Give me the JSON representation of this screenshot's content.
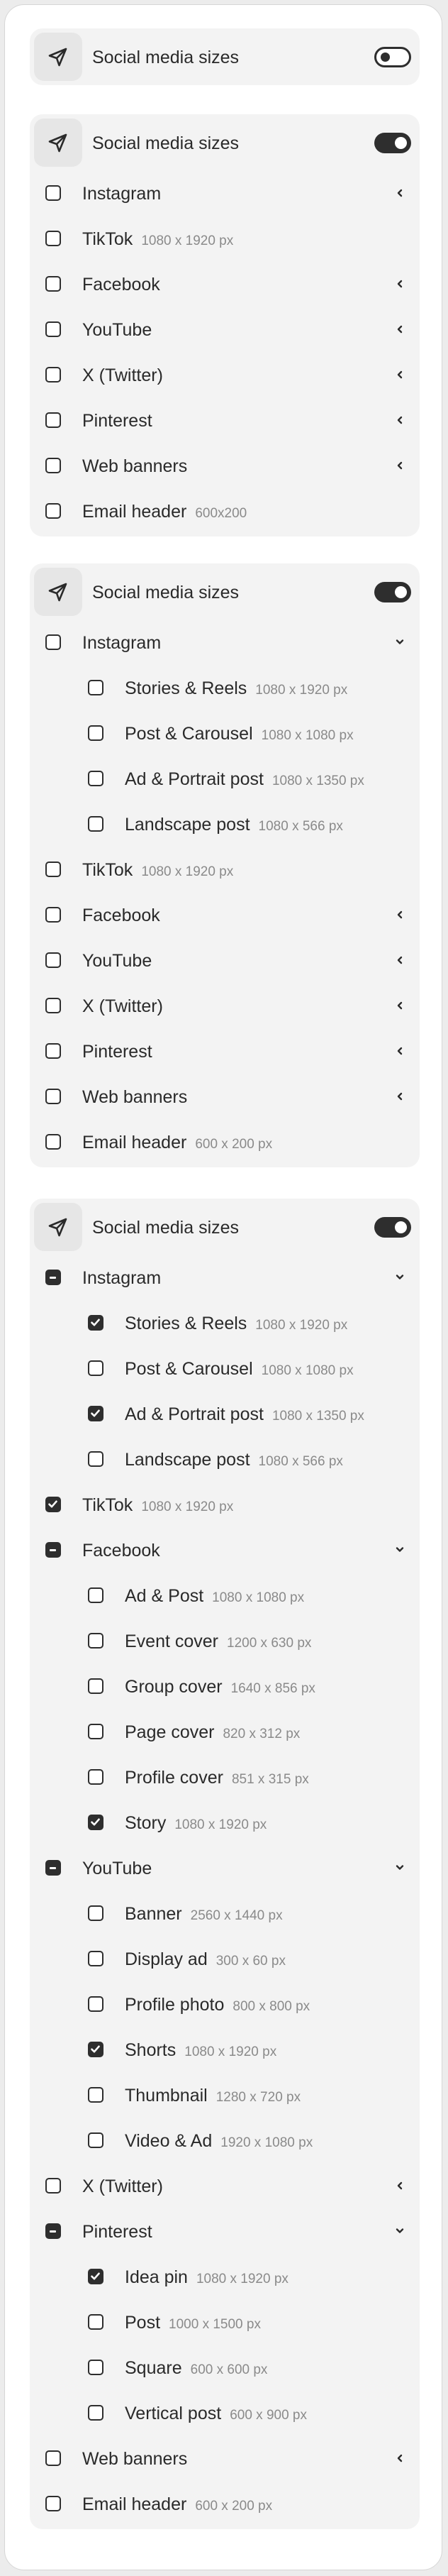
{
  "title": "Social media sizes",
  "cards": [
    {
      "toggle": "off",
      "items": []
    },
    {
      "toggle": "on",
      "items": [
        {
          "label": "Instagram",
          "state": "unchecked",
          "chevron": "left"
        },
        {
          "label": "TikTok",
          "size": "1080 x 1920 px",
          "state": "unchecked"
        },
        {
          "label": "Facebook",
          "state": "unchecked",
          "chevron": "left"
        },
        {
          "label": "YouTube",
          "state": "unchecked",
          "chevron": "left"
        },
        {
          "label": "X (Twitter)",
          "state": "unchecked",
          "chevron": "left"
        },
        {
          "label": "Pinterest",
          "state": "unchecked",
          "chevron": "left"
        },
        {
          "label": "Web banners",
          "state": "unchecked",
          "chevron": "left"
        },
        {
          "label": "Email header",
          "size": "600x200",
          "state": "unchecked"
        }
      ]
    },
    {
      "toggle": "on",
      "items": [
        {
          "label": "Instagram",
          "state": "unchecked",
          "chevron": "down"
        },
        {
          "label": "Stories & Reels",
          "size": "1080 x 1920 px",
          "state": "unchecked",
          "sub": true
        },
        {
          "label": "Post & Carousel",
          "size": "1080 x 1080 px",
          "state": "unchecked",
          "sub": true
        },
        {
          "label": "Ad & Portrait post",
          "size": "1080 x 1350 px",
          "state": "unchecked",
          "sub": true
        },
        {
          "label": "Landscape post",
          "size": "1080 x 566 px",
          "state": "unchecked",
          "sub": true
        },
        {
          "label": "TikTok",
          "size": "1080 x 1920 px",
          "state": "unchecked"
        },
        {
          "label": "Facebook",
          "state": "unchecked",
          "chevron": "left"
        },
        {
          "label": "YouTube",
          "state": "unchecked",
          "chevron": "left"
        },
        {
          "label": "X (Twitter)",
          "state": "unchecked",
          "chevron": "left"
        },
        {
          "label": "Pinterest",
          "state": "unchecked",
          "chevron": "left"
        },
        {
          "label": "Web banners",
          "state": "unchecked",
          "chevron": "left"
        },
        {
          "label": "Email header",
          "size": "600 x 200 px",
          "state": "unchecked"
        }
      ]
    },
    {
      "toggle": "on",
      "items": [
        {
          "label": "Instagram",
          "state": "partial",
          "chevron": "down"
        },
        {
          "label": "Stories & Reels",
          "size": "1080 x 1920 px",
          "state": "checked",
          "sub": true
        },
        {
          "label": "Post & Carousel",
          "size": "1080 x 1080 px",
          "state": "unchecked",
          "sub": true
        },
        {
          "label": "Ad & Portrait post",
          "size": "1080 x 1350 px",
          "state": "checked",
          "sub": true
        },
        {
          "label": "Landscape post",
          "size": "1080 x 566 px",
          "state": "unchecked",
          "sub": true
        },
        {
          "label": "TikTok",
          "size": "1080 x 1920 px",
          "state": "checked"
        },
        {
          "label": "Facebook",
          "state": "partial",
          "chevron": "down"
        },
        {
          "label": "Ad & Post",
          "size": "1080 x 1080 px",
          "state": "unchecked",
          "sub": true
        },
        {
          "label": "Event cover",
          "size": "1200 x 630 px",
          "state": "unchecked",
          "sub": true
        },
        {
          "label": "Group cover",
          "size": "1640 x 856 px",
          "state": "unchecked",
          "sub": true
        },
        {
          "label": "Page cover",
          "size": "820 x 312 px",
          "state": "unchecked",
          "sub": true
        },
        {
          "label": "Profile cover",
          "size": "851 x 315 px",
          "state": "unchecked",
          "sub": true
        },
        {
          "label": "Story",
          "size": "1080 x 1920 px",
          "state": "checked",
          "sub": true
        },
        {
          "label": "YouTube",
          "state": "partial",
          "chevron": "down"
        },
        {
          "label": "Banner",
          "size": "2560 x 1440 px",
          "state": "unchecked",
          "sub": true
        },
        {
          "label": "Display ad",
          "size": "300 x 60 px",
          "state": "unchecked",
          "sub": true
        },
        {
          "label": "Profile photo",
          "size": "800 x 800 px",
          "state": "unchecked",
          "sub": true
        },
        {
          "label": "Shorts",
          "size": "1080 x 1920 px",
          "state": "checked",
          "sub": true
        },
        {
          "label": "Thumbnail",
          "size": "1280 x 720 px",
          "state": "unchecked",
          "sub": true
        },
        {
          "label": "Video & Ad",
          "size": "1920 x 1080 px",
          "state": "unchecked",
          "sub": true
        },
        {
          "label": "X (Twitter)",
          "state": "unchecked",
          "chevron": "left"
        },
        {
          "label": "Pinterest",
          "state": "partial",
          "chevron": "down"
        },
        {
          "label": "Idea pin",
          "size": "1080 x 1920 px",
          "state": "checked",
          "sub": true
        },
        {
          "label": "Post",
          "size": "1000 x 1500 px",
          "state": "unchecked",
          "sub": true
        },
        {
          "label": "Square",
          "size": "600 x 600 px",
          "state": "unchecked",
          "sub": true
        },
        {
          "label": "Vertical post",
          "size": "600 x 900 px",
          "state": "unchecked",
          "sub": true
        },
        {
          "label": "Web banners",
          "state": "unchecked",
          "chevron": "left"
        },
        {
          "label": "Email header",
          "size": "600 x 200 px",
          "state": "unchecked"
        }
      ]
    }
  ]
}
